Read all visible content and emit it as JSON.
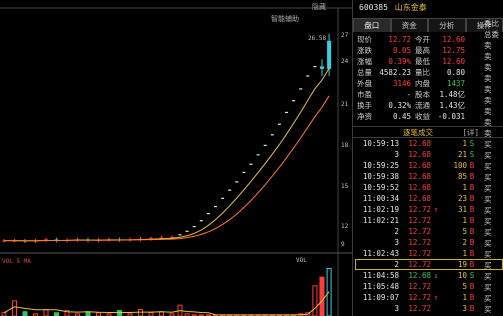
{
  "toolbar": {
    "zoom_btn": "隐藏",
    "assist_btn": "智能辅助",
    "vol_label": "VOL"
  },
  "chart_data": {
    "type": "candlestick",
    "price_labels": [
      "26.58",
      "27",
      "24",
      "21",
      "18",
      "15",
      "12",
      "9"
    ],
    "closes": [
      9.6,
      9.6,
      9.55,
      9.6,
      9.7,
      9.6,
      9.65,
      9.7,
      9.6,
      9.65,
      9.7,
      9.65,
      9.7,
      9.75,
      9.8,
      9.85,
      9.9,
      10.1,
      10.4,
      10.8,
      11.3,
      11.9,
      12.5,
      13.2,
      13.9,
      14.6,
      15.4,
      16.1,
      16.9,
      17.7,
      18.6,
      19.5,
      20.5,
      21.5,
      22.5,
      23.6,
      24.4,
      24.2,
      26.58
    ],
    "volume_title": "VOL 5 MA",
    "colors": {
      "up": "#ff3b3b",
      "down": "#2ec85a",
      "ma1": "#e8c040",
      "ma2": "#ff7a2a"
    }
  },
  "panel": {
    "stock_code": "600385",
    "stock_name": "山东金泰",
    "tabs": [
      {
        "label": "盘口",
        "active": true
      },
      {
        "label": "资金",
        "active": false
      },
      {
        "label": "分析",
        "active": false
      },
      {
        "label": "操作",
        "active": false
      }
    ],
    "quote": [
      {
        "l1": "现价",
        "v1": "12.72",
        "c1": "up",
        "l2": "今开",
        "v2": "12.60",
        "c2": "up",
        "l3": "委比"
      },
      {
        "l1": "涨跌",
        "v1": "0.05",
        "c1": "up",
        "l2": "最高",
        "v2": "12.75",
        "c2": "up",
        "l3": "总委"
      },
      {
        "l1": "涨幅",
        "v1": "0.39%",
        "c1": "up",
        "l2": "最低",
        "v2": "12.60",
        "c2": "up",
        "l3": "卖"
      },
      {
        "l1": "总量",
        "v1": "4582.23",
        "c1": "neu",
        "l2": "量比",
        "v2": "0.80",
        "c2": "neu",
        "l3": "卖"
      },
      {
        "l1": "外盘",
        "v1": "3146",
        "c1": "up",
        "l2": "内盘",
        "v2": "1437",
        "c2": "dn",
        "l3": "卖"
      },
      {
        "l1": "市盈",
        "v1": "-",
        "c1": "neu",
        "l2": "股本",
        "v2": "1.48亿",
        "c2": "neu",
        "l3": "卖"
      },
      {
        "l1": "换手",
        "v1": "0.32%",
        "c1": "neu",
        "l2": "流通",
        "v2": "1.43亿",
        "c2": "neu",
        "l3": "卖"
      },
      {
        "l1": "净资",
        "v1": "0.45",
        "c1": "neu",
        "l2": "收益",
        "v2": "-0.031",
        "c2": "neu",
        "l3": "卖"
      }
    ],
    "trades_title": "逐笔成交",
    "trades_detail": "[详]",
    "trades": [
      {
        "t": "10:59:13",
        "p": "12.68",
        "a": "",
        "v": "1",
        "s": "S",
        "sc": "dn",
        "hl": false
      },
      {
        "t": "3",
        "p": "12.68",
        "a": "",
        "v": "21",
        "s": "S",
        "sc": "dn",
        "hl": false
      },
      {
        "t": "10:59:25",
        "p": "12.68",
        "a": "",
        "v": "100",
        "s": "B",
        "sc": "up",
        "hl": false
      },
      {
        "t": "10:59:38",
        "p": "12.68",
        "a": "",
        "v": "85",
        "s": "B",
        "sc": "up",
        "hl": false
      },
      {
        "t": "10:59:52",
        "p": "12.68",
        "a": "",
        "v": "1",
        "s": "B",
        "sc": "up",
        "hl": false
      },
      {
        "t": "11:00:34",
        "p": "12.68",
        "a": "",
        "v": "23",
        "s": "B",
        "sc": "up",
        "hl": false
      },
      {
        "t": "11:02:19",
        "p": "12.72",
        "a": "↑",
        "v": "31",
        "s": "B",
        "sc": "up",
        "hl": false
      },
      {
        "t": "11:02:21",
        "p": "12.72",
        "a": "",
        "v": "1",
        "s": "B",
        "sc": "up",
        "hl": false
      },
      {
        "t": "2",
        "p": "12.72",
        "a": "",
        "v": "5",
        "s": "B",
        "sc": "up",
        "hl": false
      },
      {
        "t": "3",
        "p": "12.72",
        "a": "",
        "v": "2",
        "s": "B",
        "sc": "up",
        "hl": false
      },
      {
        "t": "11:02:43",
        "p": "12.72",
        "a": "",
        "v": "1",
        "s": "B",
        "sc": "up",
        "hl": false
      },
      {
        "t": "2",
        "p": "12.72",
        "a": "",
        "v": "19",
        "s": "B",
        "sc": "up",
        "hl": true
      },
      {
        "t": "11:04:58",
        "p": "12.68",
        "a": "↓",
        "v": "10",
        "s": "S",
        "sc": "dn",
        "hl": false
      },
      {
        "t": "11:05:48",
        "p": "12.72",
        "a": "",
        "v": "5",
        "s": "B",
        "sc": "up",
        "hl": false
      },
      {
        "t": "11:09:07",
        "p": "12.72",
        "a": "↑",
        "v": "1",
        "s": "B",
        "sc": "up",
        "hl": false
      },
      {
        "t": "3",
        "p": "12.72",
        "a": "",
        "v": "3",
        "s": "B",
        "sc": "up",
        "hl": false
      }
    ],
    "side_labels": [
      "委比",
      "总委",
      "卖",
      "卖",
      "卖",
      "卖",
      "卖",
      "卖",
      "卖",
      "卖",
      "卖",
      "买",
      "买",
      "买",
      "买",
      "买",
      "买",
      "买",
      "买",
      "买",
      "买",
      "买",
      "买",
      "买",
      "买",
      "买",
      "买"
    ]
  }
}
